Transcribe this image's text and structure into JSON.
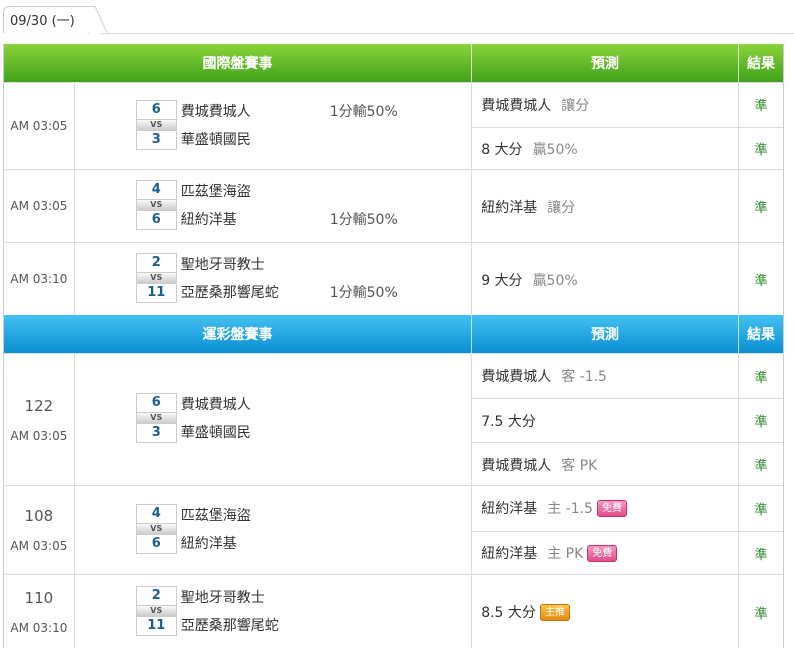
{
  "tab": {
    "date": "09/30 (一)"
  },
  "section1": {
    "header": {
      "left": "國際盤賽事",
      "pred": "預測",
      "result": "結果"
    },
    "rows": [
      {
        "time": "AM 03:05",
        "home_score": "6",
        "away_score": "3",
        "vs": "VS",
        "team1": "費城費城人",
        "team2": "華盛頓國民",
        "handicap": "1分輸50%",
        "handicap_line": 1,
        "preds": [
          {
            "main": "費城費城人",
            "sub": "讓分",
            "res": "準"
          },
          {
            "main": "8 大分",
            "sub": "贏50%",
            "res": "準"
          }
        ]
      },
      {
        "time": "AM 03:05",
        "home_score": "4",
        "away_score": "6",
        "vs": "VS",
        "team1": "匹茲堡海盜",
        "team2": "紐約洋基",
        "handicap": "1分輸50%",
        "handicap_line": 2,
        "preds": [
          {
            "main": "紐約洋基",
            "sub": "讓分",
            "res": "準"
          }
        ]
      },
      {
        "time": "AM 03:10",
        "home_score": "2",
        "away_score": "11",
        "vs": "VS",
        "team1": "聖地牙哥教士",
        "team2": "亞歷桑那響尾蛇",
        "handicap": "1分輸50%",
        "handicap_line": 2,
        "preds": [
          {
            "main": "9 大分",
            "sub": "贏50%",
            "res": "準"
          }
        ]
      }
    ]
  },
  "section2": {
    "header": {
      "left": "運彩盤賽事",
      "pred": "預測",
      "result": "結果"
    },
    "rows": [
      {
        "no": "122",
        "time": "AM 03:05",
        "home_score": "6",
        "away_score": "3",
        "vs": "VS",
        "team1": "費城費城人",
        "team2": "華盛頓國民",
        "preds": [
          {
            "main": "費城費城人",
            "sub": "客 -1.5",
            "res": "準"
          },
          {
            "main": "7.5 大分",
            "sub": "",
            "res": "準"
          },
          {
            "main": "費城費城人",
            "sub": "客 PK",
            "res": "準"
          }
        ]
      },
      {
        "no": "108",
        "time": "AM 03:05",
        "home_score": "4",
        "away_score": "6",
        "vs": "VS",
        "team1": "匹茲堡海盜",
        "team2": "紐約洋基",
        "preds": [
          {
            "main": "紐約洋基",
            "sub": "主 -1.5",
            "badge": "免費",
            "badge_type": "free",
            "res": "準"
          },
          {
            "main": "紐約洋基",
            "sub": "主 PK",
            "badge": "免費",
            "badge_type": "free",
            "res": "準"
          }
        ]
      },
      {
        "no": "110",
        "time": "AM 03:10",
        "home_score": "2",
        "away_score": "11",
        "vs": "VS",
        "team1": "聖地牙哥教士",
        "team2": "亞歷桑那響尾蛇",
        "preds": [
          {
            "main": "8.5 大分",
            "sub": "",
            "badge": "主推",
            "badge_type": "main",
            "res": "準"
          }
        ]
      }
    ]
  }
}
